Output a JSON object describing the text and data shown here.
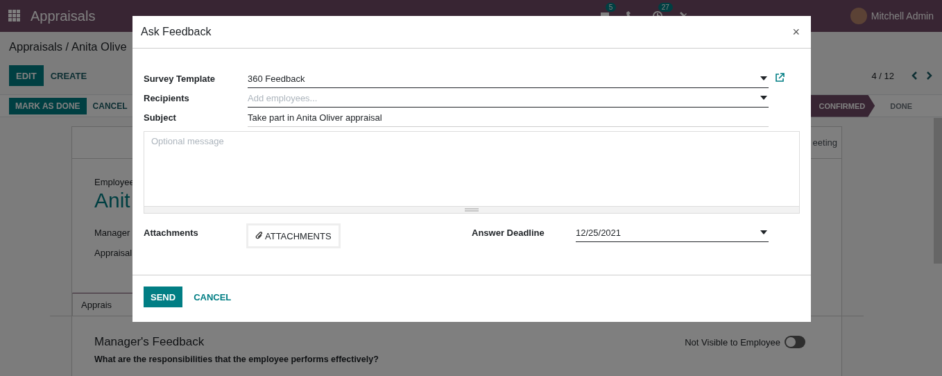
{
  "navbar": {
    "app_name": "Appraisals",
    "systray": [
      {
        "kind": "chat",
        "badge": "5"
      },
      {
        "kind": "phone"
      },
      {
        "kind": "activity",
        "badge": "27"
      },
      {
        "kind": "tools"
      }
    ],
    "user": "Mitchell Admin"
  },
  "breadcrumb": "Appraisals / Anita Olive",
  "buttons": [
    {
      "label": "EDIT",
      "kind": "primary"
    },
    {
      "label": "CREATE",
      "kind": "secondary"
    }
  ],
  "pager": "4 / 12",
  "statusbar": {
    "buttons": [
      {
        "label": "MARK AS DONE",
        "kind": "primary"
      },
      {
        "label": "CANCEL",
        "kind": "secondary"
      }
    ],
    "stages": [
      {
        "label": "CONFIRMED",
        "selected": true
      },
      {
        "label": "DONE",
        "selected": false
      }
    ]
  },
  "sheet": {
    "button_box": [
      "eeting"
    ],
    "employee_label": "Employee",
    "employee_name": "Anit",
    "fields": [
      "Manager",
      "Appraisal"
    ],
    "tabs": [
      {
        "label": "Apprais",
        "selected": true
      }
    ],
    "section_title": "Manager's Feedback",
    "question": "What are the responsibilities that the employee performs effectively?",
    "visibility": {
      "label": "Not Visible to Employee",
      "on": false
    }
  },
  "dialog": {
    "title": "Ask Feedback",
    "close": "×",
    "fields": [
      {
        "label": "Survey Template",
        "value": "360 Feedback",
        "kind": "dropdown",
        "external_link": true
      },
      {
        "label": "Recipients",
        "placeholder": "Add employees...",
        "kind": "dropdown",
        "external_link": false
      },
      {
        "label": "Subject",
        "value": "Take part in Anita Oliver appraisal",
        "kind": "text",
        "external_link": false
      }
    ],
    "message": {
      "placeholder": "Optional message"
    },
    "attachments": {
      "label": "Attachments",
      "button": "ATTACHMENTS"
    },
    "deadline": {
      "label": "Answer Deadline",
      "value": "12/25/2021"
    },
    "buttons": [
      {
        "label": "SEND",
        "kind": "primary"
      },
      {
        "label": "CANCEL",
        "kind": "link"
      }
    ]
  }
}
